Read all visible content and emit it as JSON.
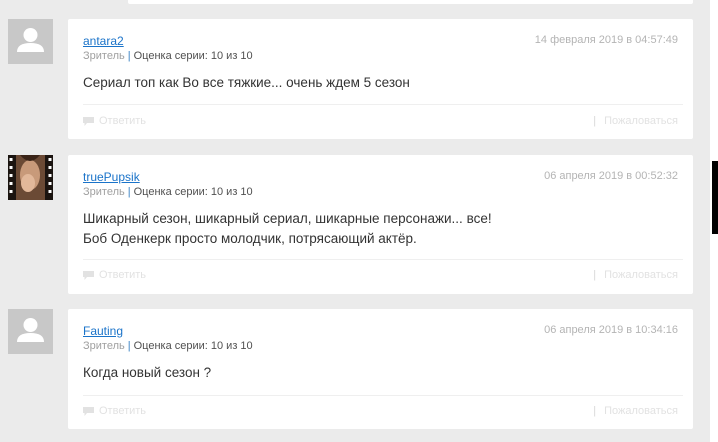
{
  "ui": {
    "sep": "|",
    "reply_label": "Ответить",
    "report_label": "Пожаловаться"
  },
  "comments": [
    {
      "author": "antara2",
      "role": "Зритель",
      "rating": "Оценка серии: 10 из 10",
      "date": "14 февраля 2019 в 04:57:49",
      "lines": [
        "Сериал топ как Во все тяжкие... очень ждем 5 сезон"
      ],
      "avatar": "default-user-icon"
    },
    {
      "author": "truePupsik",
      "role": "Зритель",
      "rating": "Оценка серии: 10 из 10",
      "date": "06 апреля 2019 в 00:52:32",
      "lines": [
        "Шикарный сезон, шикарный сериал, шикарные персонажи... все!",
        "Боб Оденкерк просто молодчик, потрясающий актёр."
      ],
      "avatar": "film-strip-photo"
    },
    {
      "author": "Fauting",
      "role": "Зритель",
      "rating": "Оценка серии: 10 из 10",
      "date": "06 апреля 2019 в 10:34:16",
      "lines": [
        "Когда новый сезон ?"
      ],
      "avatar": "default-user-icon"
    }
  ]
}
